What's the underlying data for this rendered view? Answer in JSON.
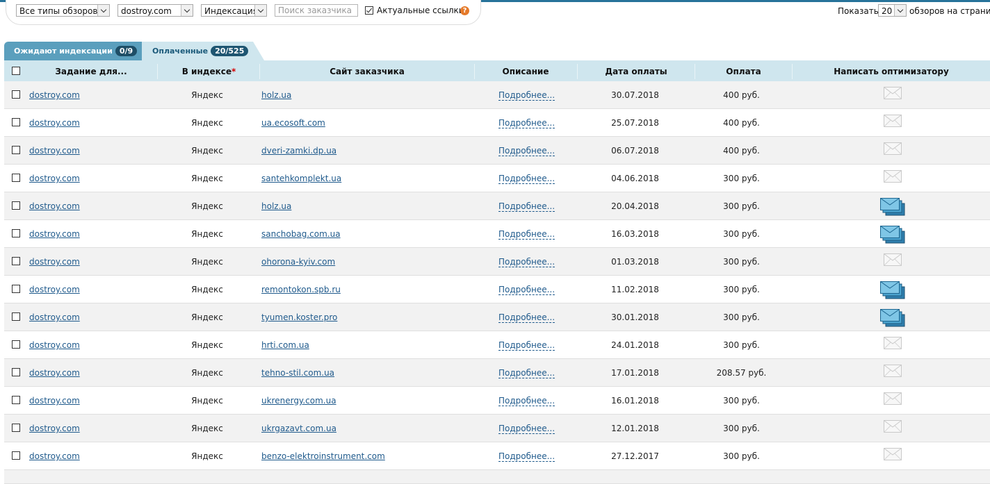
{
  "filters": {
    "review_type": "Все типы обзоров",
    "site": "dostroy.com",
    "status": "Индексация",
    "search_placeholder": "Поиск заказчика",
    "actual_links_label": "Актуальные ссылки",
    "actual_links_checked": true,
    "help": "?"
  },
  "pager": {
    "show_label": "Показать",
    "per_page": "20",
    "suffix": "обзоров на страниц"
  },
  "tabs": [
    {
      "label": "Ожидают индексации",
      "count": "0/9"
    },
    {
      "label": "Оплаченные",
      "count": "20/525"
    }
  ],
  "table": {
    "headers": {
      "task": "Задание для...",
      "in_index": "В индексе",
      "in_index_mark": "*",
      "customer_site": "Сайт заказчика",
      "description": "Описание",
      "pay_date": "Дата оплаты",
      "payment": "Оплата",
      "write": "Написать оптимизатору"
    },
    "rows": [
      {
        "task": "dostroy.com",
        "index": "Яндекс",
        "site": "holz.ua",
        "desc": "Подробнее...",
        "date": "30.07.2018",
        "pay": "400 руб.",
        "mail": "grey-envelope-icon"
      },
      {
        "task": "dostroy.com",
        "index": "Яндекс",
        "site": "ua.ecosoft.com",
        "desc": "Подробнее...",
        "date": "25.07.2018",
        "pay": "400 руб.",
        "mail": "grey-envelope-icon"
      },
      {
        "task": "dostroy.com",
        "index": "Яндекс",
        "site": "dveri-zamki.dp.ua",
        "desc": "Подробнее...",
        "date": "06.07.2018",
        "pay": "400 руб.",
        "mail": "grey-envelope-icon"
      },
      {
        "task": "dostroy.com",
        "index": "Яндекс",
        "site": "santehkomplekt.ua",
        "desc": "Подробнее...",
        "date": "04.06.2018",
        "pay": "300 руб.",
        "mail": "grey-envelope-icon"
      },
      {
        "task": "dostroy.com",
        "index": "Яндекс",
        "site": "holz.ua",
        "desc": "Подробнее...",
        "date": "20.04.2018",
        "pay": "300 руб.",
        "mail": "blue-envelopes-icon"
      },
      {
        "task": "dostroy.com",
        "index": "Яндекс",
        "site": "sanchobag.com.ua",
        "desc": "Подробнее...",
        "date": "16.03.2018",
        "pay": "300 руб.",
        "mail": "blue-envelopes-icon"
      },
      {
        "task": "dostroy.com",
        "index": "Яндекс",
        "site": "ohorona-kyiv.com",
        "desc": "Подробнее...",
        "date": "01.03.2018",
        "pay": "300 руб.",
        "mail": "grey-envelope-icon"
      },
      {
        "task": "dostroy.com",
        "index": "Яндекс",
        "site": "remontokon.spb.ru",
        "desc": "Подробнее...",
        "date": "11.02.2018",
        "pay": "300 руб.",
        "mail": "blue-envelopes-icon"
      },
      {
        "task": "dostroy.com",
        "index": "Яндекс",
        "site": "tyumen.koster.pro",
        "desc": "Подробнее...",
        "date": "30.01.2018",
        "pay": "300 руб.",
        "mail": "blue-envelopes-icon"
      },
      {
        "task": "dostroy.com",
        "index": "Яндекс",
        "site": "hrti.com.ua",
        "desc": "Подробнее...",
        "date": "24.01.2018",
        "pay": "300 руб.",
        "mail": "grey-envelope-icon"
      },
      {
        "task": "dostroy.com",
        "index": "Яндекс",
        "site": "tehno-stil.com.ua",
        "desc": "Подробнее...",
        "date": "17.01.2018",
        "pay": "208.57 руб.",
        "mail": "grey-envelope-icon"
      },
      {
        "task": "dostroy.com",
        "index": "Яндекс",
        "site": "ukrenergy.com.ua",
        "desc": "Подробнее...",
        "date": "16.01.2018",
        "pay": "300 руб.",
        "mail": "grey-envelope-icon"
      },
      {
        "task": "dostroy.com",
        "index": "Яндекс",
        "site": "ukrgazavt.com.ua",
        "desc": "Подробнее...",
        "date": "12.01.2018",
        "pay": "300 руб.",
        "mail": "grey-envelope-icon"
      },
      {
        "task": "dostroy.com",
        "index": "Яндекс",
        "site": "benzo-elektroinstrument.com",
        "desc": "Подробнее...",
        "date": "27.12.2017",
        "pay": "300 руб.",
        "mail": "grey-envelope-icon"
      }
    ]
  }
}
